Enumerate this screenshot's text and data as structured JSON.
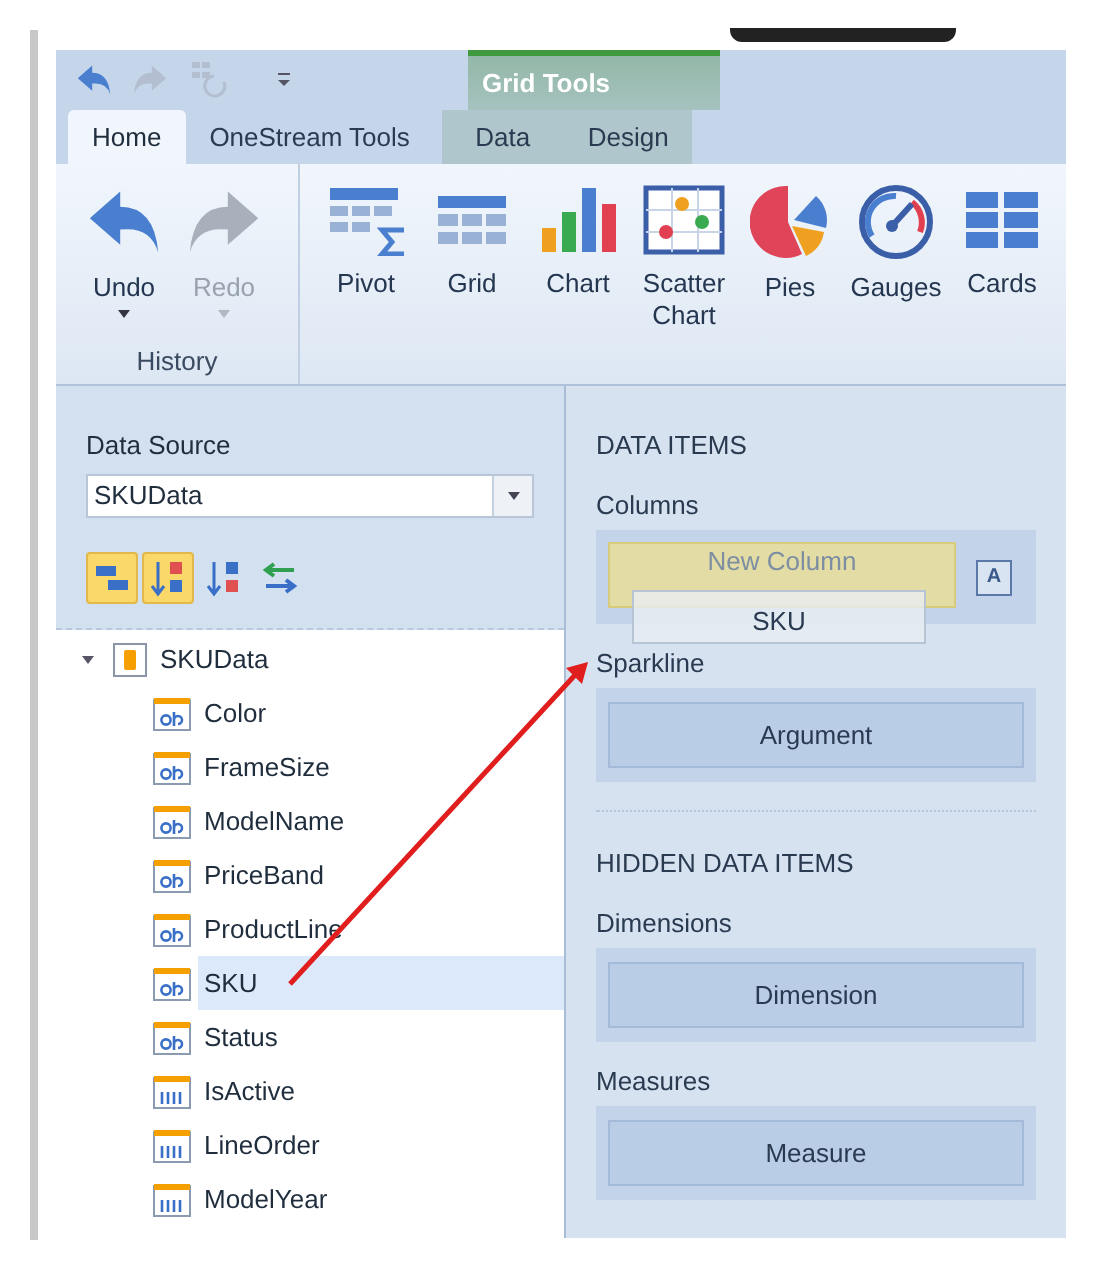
{
  "quick_access": [
    {
      "kind": "undo",
      "disabled": false
    },
    {
      "kind": "redo",
      "disabled": true
    },
    {
      "kind": "refresh",
      "disabled": true
    },
    {
      "kind": "customize",
      "disabled": false
    }
  ],
  "context_group": {
    "title": "Grid Tools"
  },
  "tabs": [
    {
      "label": "Home",
      "selected": true,
      "contextual": false
    },
    {
      "label": "OneStream Tools",
      "selected": false,
      "contextual": false
    },
    {
      "label": "Data",
      "selected": false,
      "contextual": true
    },
    {
      "label": "Design",
      "selected": false,
      "contextual": true
    }
  ],
  "ribbon_groups": [
    {
      "label": "History",
      "buttons": [
        {
          "kind": "undo",
          "label": "Undo",
          "disabled": false,
          "dropdown": true
        },
        {
          "kind": "redo",
          "label": "Redo",
          "disabled": true,
          "dropdown": true
        }
      ]
    },
    {
      "buttons": [
        {
          "kind": "pivot",
          "label": "Pivot",
          "disabled": false,
          "dropdown": false
        },
        {
          "kind": "grid",
          "label": "Grid",
          "disabled": false,
          "dropdown": false
        },
        {
          "kind": "chart",
          "label": "Chart",
          "disabled": false,
          "dropdown": false
        },
        {
          "kind": "scatter",
          "label": "Scatter Chart",
          "disabled": false,
          "dropdown": false
        },
        {
          "kind": "pies",
          "label": "Pies",
          "disabled": false,
          "dropdown": false
        },
        {
          "kind": "gauges",
          "label": "Gauges",
          "disabled": false,
          "dropdown": false
        },
        {
          "kind": "cards",
          "label": "Cards",
          "disabled": false,
          "dropdown": false
        }
      ]
    }
  ],
  "data_source": {
    "label": "Data Source",
    "value": "SKUData"
  },
  "field_toolbar": [
    {
      "kind": "group",
      "on": true
    },
    {
      "kind": "sort_asc",
      "on": true
    },
    {
      "kind": "sort_desc",
      "on": false
    },
    {
      "kind": "swap",
      "on": false
    }
  ],
  "tree": [
    {
      "label": "SKUData",
      "kind": "source",
      "expanded": true,
      "selected": false,
      "children": [
        {
          "label": "Color",
          "kind": "text",
          "selected": false
        },
        {
          "label": "FrameSize",
          "kind": "text",
          "selected": false
        },
        {
          "label": "ModelName",
          "kind": "text",
          "selected": false
        },
        {
          "label": "PriceBand",
          "kind": "text",
          "selected": false
        },
        {
          "label": "ProductLine",
          "kind": "text",
          "selected": false
        },
        {
          "label": "SKU",
          "kind": "text",
          "selected": true
        },
        {
          "label": "Status",
          "kind": "text",
          "selected": false
        },
        {
          "label": "IsActive",
          "kind": "number",
          "selected": false
        },
        {
          "label": "LineOrder",
          "kind": "number",
          "selected": false
        },
        {
          "label": "ModelYear",
          "kind": "number",
          "selected": false
        }
      ]
    }
  ],
  "sections": [
    {
      "title": "DATA ITEMS",
      "groups": [
        {
          "label": "Columns",
          "slot": {
            "label": "New Column",
            "highlighted": true,
            "badge": "A"
          }
        },
        {
          "label": "Sparkline",
          "slot": {
            "label": "Argument",
            "highlighted": false
          }
        }
      ]
    },
    {
      "title": "HIDDEN DATA ITEMS",
      "groups": [
        {
          "label": "Dimensions",
          "slot": {
            "label": "Dimension",
            "highlighted": false
          }
        },
        {
          "label": "Measures",
          "slot": {
            "label": "Measure",
            "highlighted": false
          }
        }
      ]
    }
  ],
  "drag_ghost": {
    "label": "SKU"
  }
}
